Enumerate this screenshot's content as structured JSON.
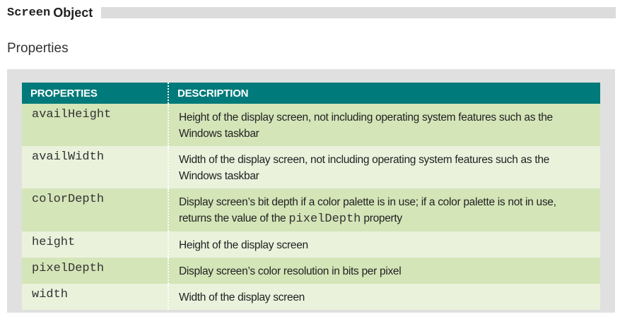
{
  "header": {
    "title_code": "Screen",
    "title_word": "Object",
    "subheading": "Properties"
  },
  "table": {
    "columns": [
      "PROPERTIES",
      "DESCRIPTION"
    ],
    "rows": [
      {
        "property": "availHeight",
        "description": "Height of the display screen, not including operating system features such as the Windows taskbar"
      },
      {
        "property": "availWidth",
        "description": "Width of the display screen, not including operating system features such as the Windows taskbar"
      },
      {
        "property": "colorDepth",
        "description_before": "Display screen’s bit depth if a color palette is in use; if a color palette is not in use, returns the value of the ",
        "description_code": "pixelDepth",
        "description_after": " property"
      },
      {
        "property": "height",
        "description": "Height of the display screen"
      },
      {
        "property": "pixelDepth",
        "description": "Display screen’s color resolution in bits per pixel"
      },
      {
        "property": "width",
        "description": "Width of the display screen"
      }
    ]
  },
  "colors": {
    "header_teal": "#007a7a",
    "row_dark": "#d4e5b8",
    "row_light": "#eaf2dc",
    "panel_gray": "#e0e0e0"
  }
}
